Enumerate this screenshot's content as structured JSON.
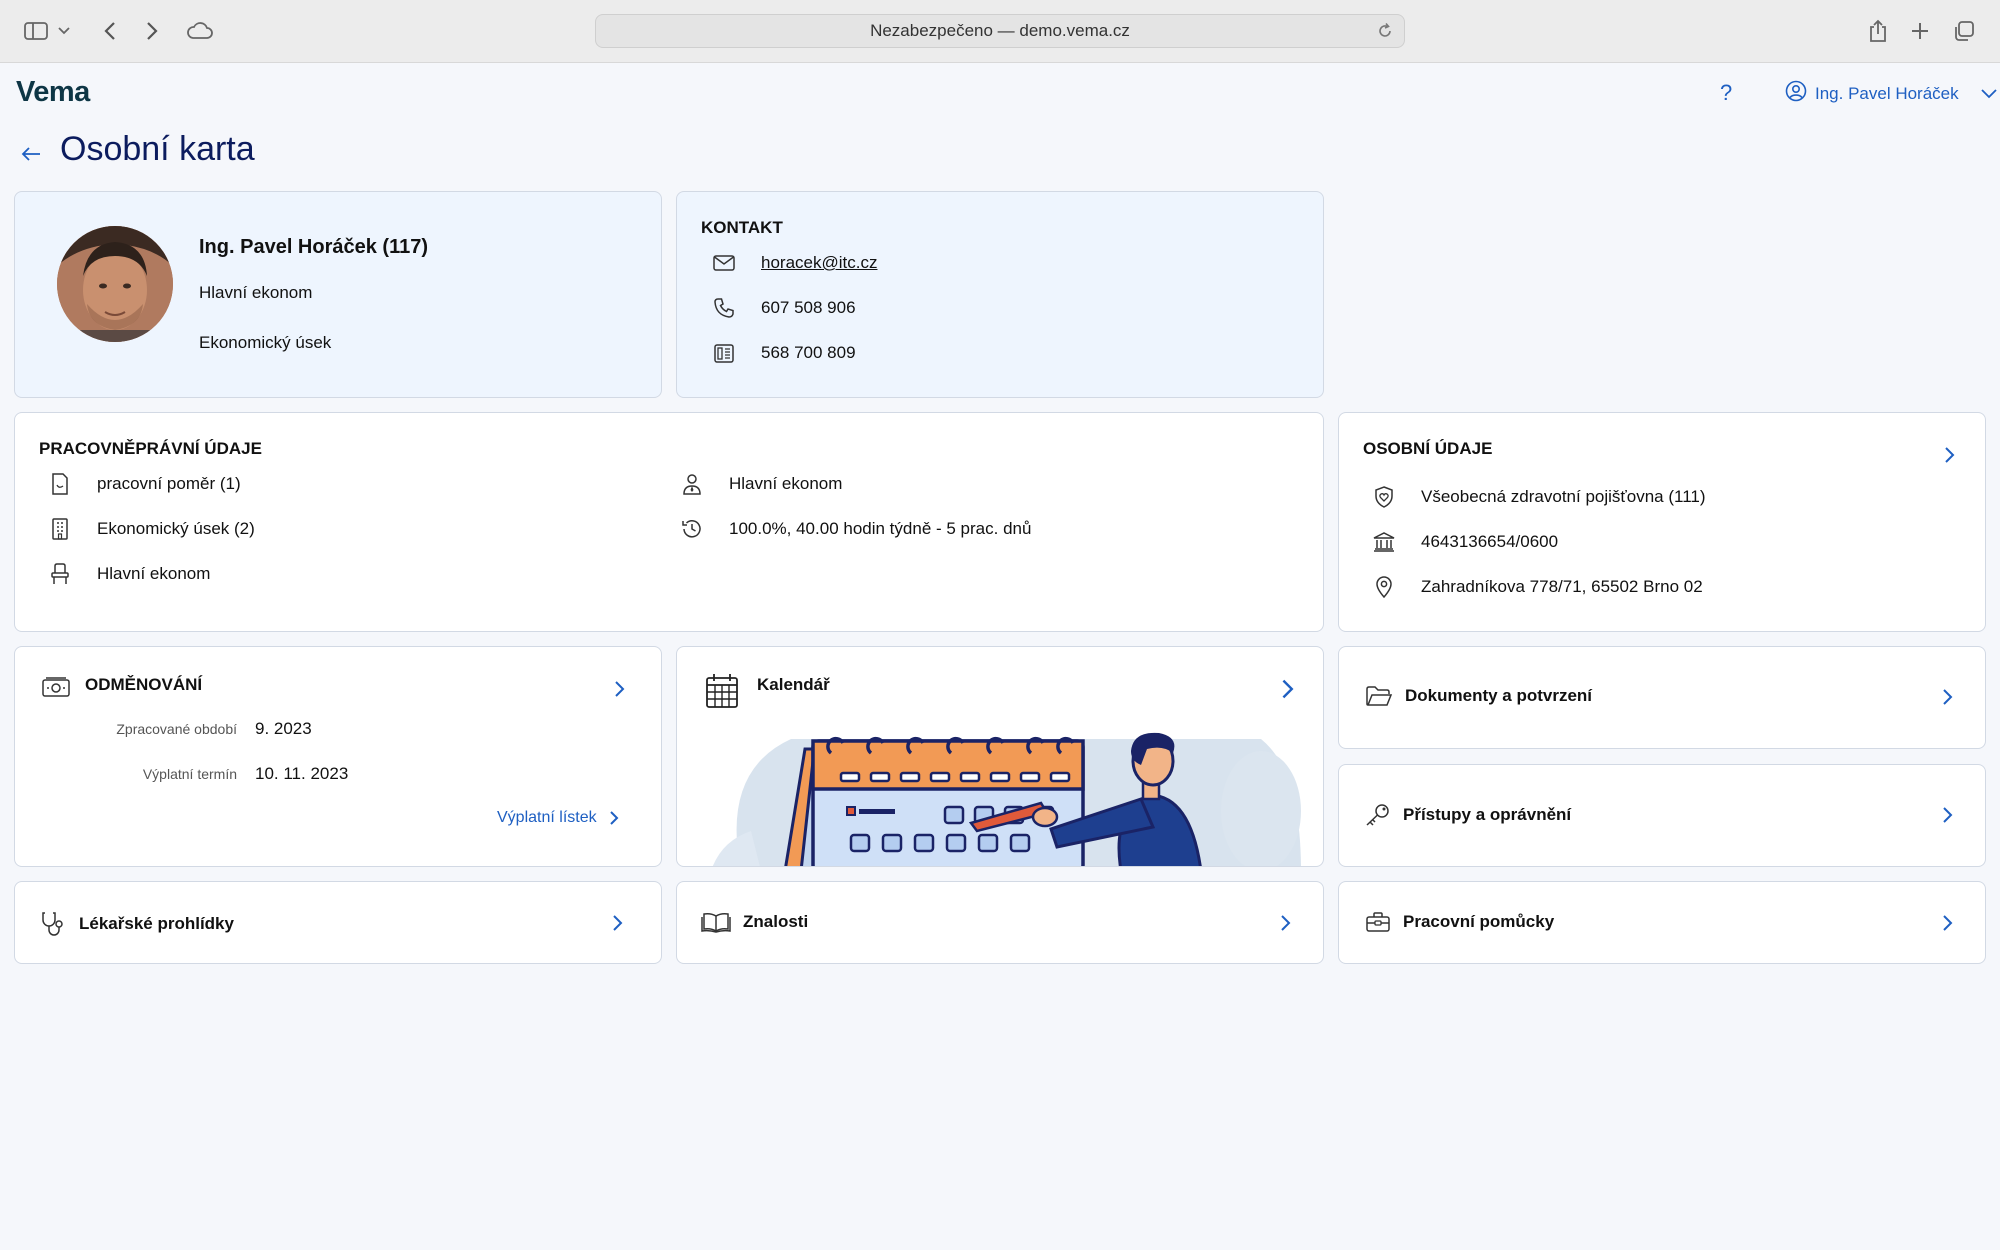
{
  "browser": {
    "address": "Nezabezpečeno — demo.vema.cz"
  },
  "header": {
    "logo": "Vema",
    "help": "?",
    "user_name": "Ing. Pavel Horáček"
  },
  "page": {
    "title": "Osobní karta"
  },
  "profile": {
    "name": "Ing. Pavel Horáček (117)",
    "position": "Hlavní ekonom",
    "department": "Ekonomický úsek"
  },
  "contact": {
    "title": "KONTAKT",
    "email": "horacek@itc.cz",
    "phone": "607 508 906",
    "fax": "568 700 809"
  },
  "employment": {
    "title": "PRACOVNĚPRÁVNÍ ÚDAJE",
    "contract": "pracovní poměr (1)",
    "unit": "Ekonomický úsek (2)",
    "workplace": "Hlavní ekonom",
    "role": "Hlavní ekonom",
    "workload": "100.0%, 40.00 hodin týdně - 5 prac. dnů"
  },
  "personal": {
    "title": "OSOBNÍ ÚDAJE",
    "insurance": "Všeobecná zdravotní pojišťovna (111)",
    "bank": "4643136654/0600",
    "address": "Zahradníkova 778/71, 65502 Brno 02"
  },
  "pay": {
    "title": "ODMĚNOVÁNÍ",
    "period_label": "Zpracované období",
    "period_value": "9. 2023",
    "payday_label": "Výplatní termín",
    "payday_value": "10. 11. 2023",
    "payslip_link": "Výplatní lístek"
  },
  "calendar": {
    "title": "Kalendář"
  },
  "tiles": {
    "documents": "Dokumenty a potvrzení",
    "access": "Přístupy a oprávnění",
    "medical": "Lékařské prohlídky",
    "knowledge": "Znalosti",
    "tools": "Pracovní pomůcky"
  }
}
